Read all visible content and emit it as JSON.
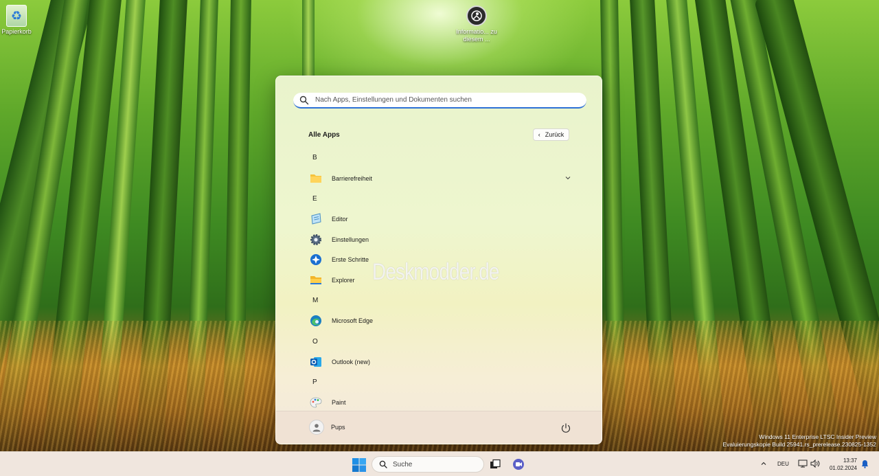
{
  "desktop": {
    "icons": [
      {
        "label": "Papierkorb",
        "icon": "recycle-bin-icon"
      },
      {
        "label": "Informatio... zu diesem ...",
        "icon": "info-icon"
      }
    ]
  },
  "start_menu": {
    "search": {
      "placeholder": "Nach Apps, Einstellungen und Dokumenten suchen"
    },
    "title": "Alle Apps",
    "back_label": "Zurück",
    "sections": [
      {
        "letter": "B",
        "apps": [
          {
            "label": "Barrierefreiheit",
            "icon": "folder-icon",
            "expandable": true
          }
        ]
      },
      {
        "letter": "E",
        "apps": [
          {
            "label": "Editor",
            "icon": "notepad-icon"
          },
          {
            "label": "Einstellungen",
            "icon": "settings-gear-icon"
          },
          {
            "label": "Erste Schritte",
            "icon": "get-started-icon"
          },
          {
            "label": "Explorer",
            "icon": "file-explorer-icon"
          }
        ]
      },
      {
        "letter": "M",
        "apps": [
          {
            "label": "Microsoft Edge",
            "icon": "edge-icon"
          }
        ]
      },
      {
        "letter": "O",
        "apps": [
          {
            "label": "Outlook (new)",
            "icon": "outlook-icon"
          }
        ]
      },
      {
        "letter": "P",
        "apps": [
          {
            "label": "Paint",
            "icon": "paint-icon"
          }
        ]
      }
    ],
    "watermark": "Deskmodder.de",
    "user": {
      "name": "Pups"
    }
  },
  "build_info": {
    "line1": "Windows 11 Enterprise LTSC Insider Preview",
    "line2": "Evaluierungskopie Build 25941.rs_prerelease.230825-1352"
  },
  "taskbar": {
    "search_label": "Suche",
    "language": "DEU",
    "time": "13:37",
    "date": "01.02.2024"
  },
  "colors": {
    "accent": "#2c6fd6",
    "taskbar_bg": "#f0e6de"
  }
}
